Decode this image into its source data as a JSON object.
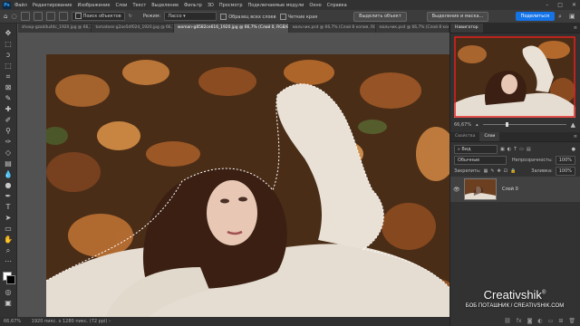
{
  "app": {
    "logo": "Ps"
  },
  "menu": [
    "Файл",
    "Редактирование",
    "Изображение",
    "Слои",
    "Текст",
    "Выделение",
    "Фильтр",
    "3D",
    "Просмотр",
    "Подключаемые модули",
    "Окно",
    "Справка"
  ],
  "options_bar": {
    "subject_select": "Поиск объектов",
    "mode_label": "Режим:",
    "mode_value": "Лассо",
    "sample_all": "Образец всех слоев",
    "hard_edge": "Четкие края",
    "select_subject": "Выделить объект",
    "select_mask": "Выделение и маска..."
  },
  "share_button": "Поделиться",
  "tabs": [
    "shoop-gzad4u44c_1920.jpg @ 66,7% (Слой...",
    "tomatoes-g2ae5df02d_1920.jpg @ 66,7% (Ц...",
    "woman-g8582ce616_1920.jpg @ 66,7% (Слой 0, RGB/8#) *",
    "мальчик.psd @ 66,7% (Слой 8 копия, RGB/8...)",
    "мальчик.psd @ 66,7% (Слой 8 копия, Цвет..."
  ],
  "status": {
    "zoom": "66,67%",
    "doc": "1920 пикс. x 1280 пикс. (72 ppi)"
  },
  "navigator": {
    "title": "Навигатор",
    "zoom": "66,67%"
  },
  "layers": {
    "tab_properties": "Свойства",
    "tab_layers": "Слои",
    "filter": "Вид",
    "blend_mode": "Обычные",
    "opacity_label": "Непрозрачность:",
    "opacity_value": "100%",
    "lock_label": "Закрепить:",
    "fill_label": "Заливка:",
    "fill_value": "100%",
    "items": [
      {
        "name": "Слой 0"
      }
    ]
  },
  "watermark": {
    "brand": "Creativshik",
    "mark": "®",
    "credit": "БОБ ПОТАШНИК / CREATIVSHIK.COM"
  },
  "colors": {
    "accent": "#1473e6",
    "panel": "#323232",
    "canvas": "#535353"
  }
}
